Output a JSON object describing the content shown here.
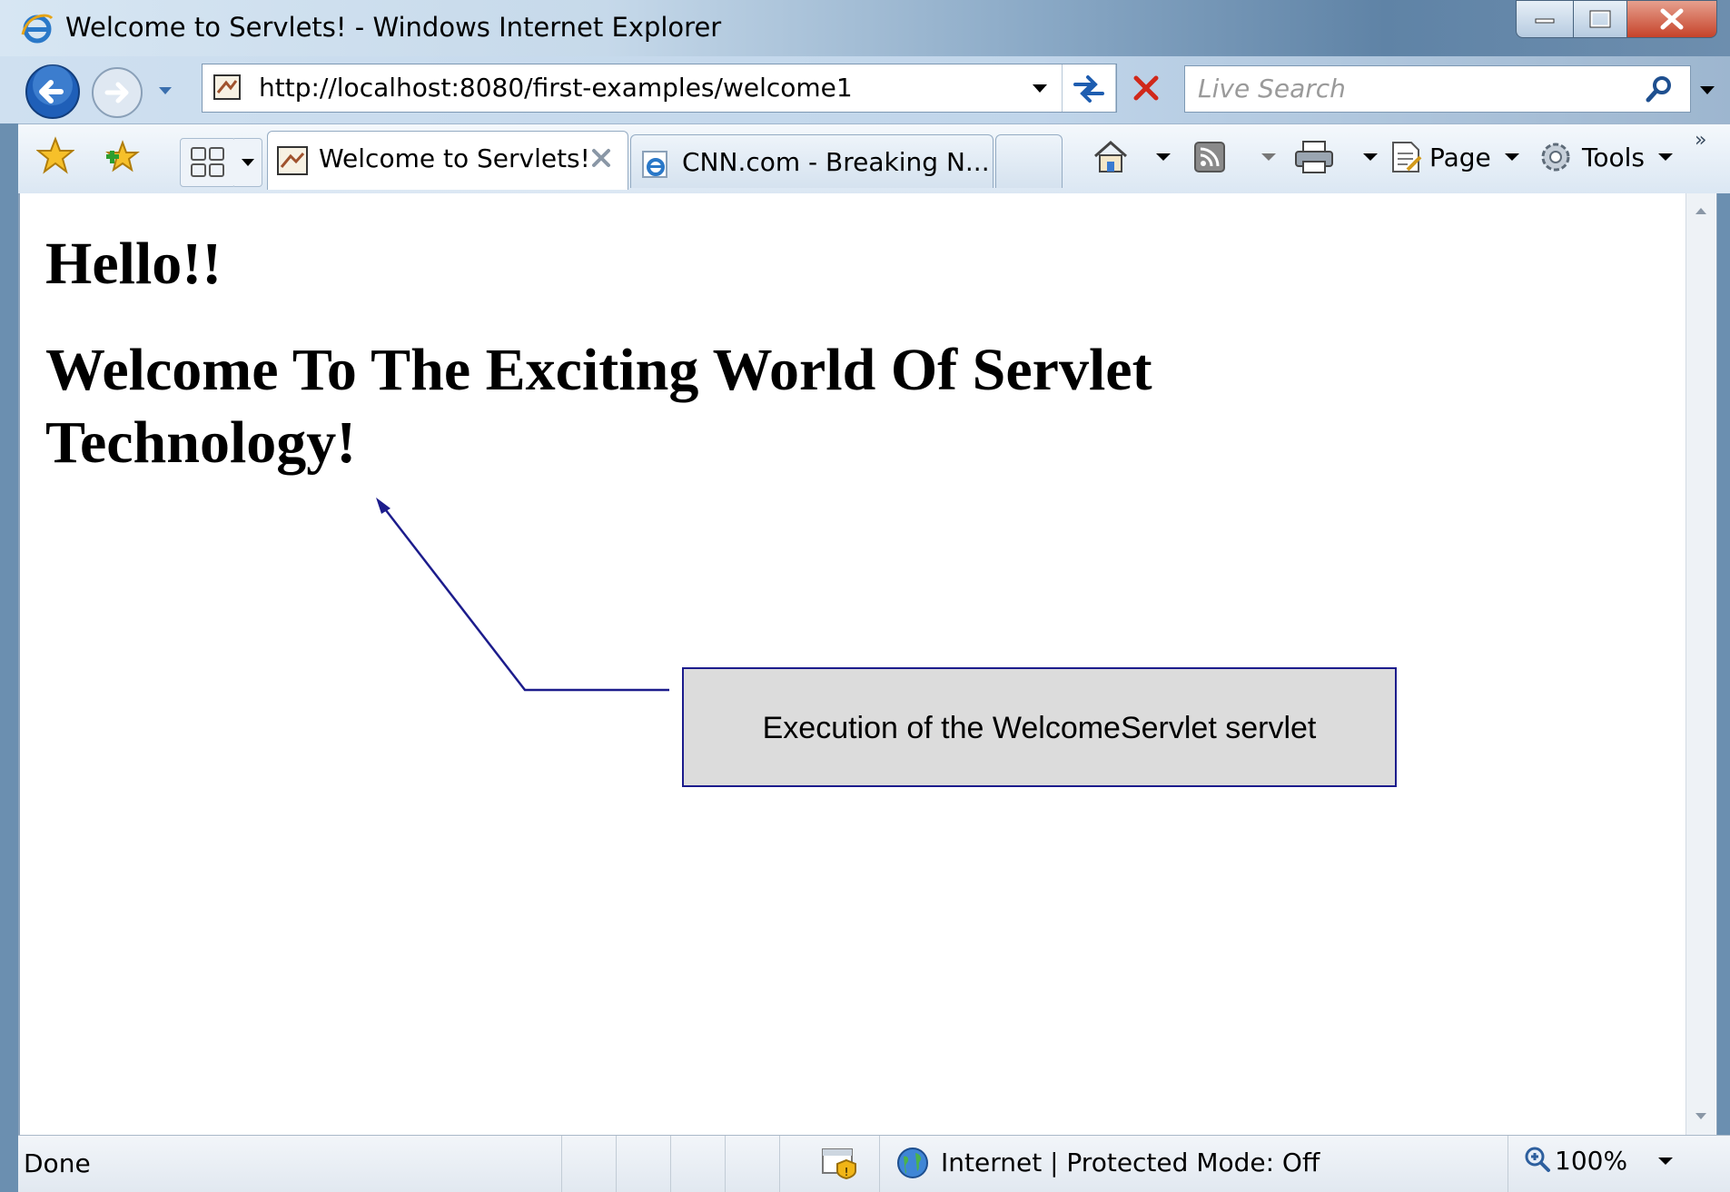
{
  "window": {
    "title": "Welcome to Servlets! - Windows Internet Explorer"
  },
  "address": {
    "url": "http://localhost:8080/first-examples/welcome1"
  },
  "search": {
    "placeholder": "Live Search"
  },
  "tabs": [
    {
      "label": "Welcome to Servlets!",
      "active": true
    },
    {
      "label": "CNN.com - Breaking N...",
      "active": false
    }
  ],
  "toolbar": {
    "page_label": "Page",
    "tools_label": "Tools",
    "more": "»"
  },
  "content": {
    "heading1": "Hello!!",
    "heading2": "Welcome To The Exciting World Of Servlet Technology!"
  },
  "callout": {
    "text": "Execution of the WelcomeServlet servlet"
  },
  "status": {
    "text": "Done",
    "zone": "Internet | Protected Mode: Off",
    "zoom": "100%"
  },
  "colors": {
    "callout_border": "#1c1c8c",
    "callout_fill": "#dcdcdc",
    "arrow": "#1c1c8c"
  },
  "icons": [
    "ie-logo-icon",
    "back-icon",
    "forward-icon",
    "refresh-icon",
    "stop-icon",
    "search-icon",
    "favorites-star-icon",
    "add-favorite-icon",
    "quick-tabs-icon",
    "home-icon",
    "feeds-icon",
    "print-icon",
    "page-icon",
    "tools-gear-icon",
    "security-shield-icon",
    "globe-icon",
    "zoom-icon"
  ]
}
